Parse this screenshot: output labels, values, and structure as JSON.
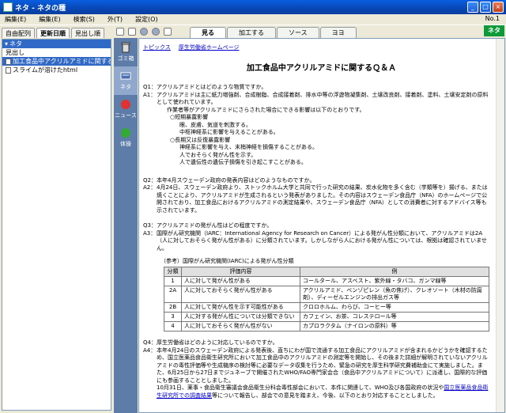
{
  "window": {
    "title": "ネタ - ネタの種",
    "buttons": [
      "_",
      "□",
      "×"
    ]
  },
  "menu": {
    "items": [
      "編集(E)",
      "編集(E)",
      "検索(S)",
      "外(T)",
      "設定(O)"
    ],
    "number": "No.1"
  },
  "left_tabs": [
    "自由配列",
    "更新日順",
    "見出し順"
  ],
  "tree": {
    "root": "ネタ",
    "items": [
      "見出し",
      "加工食品中アクリルアミドに関するＱ＆Ａ.html",
      "スライムが溶けたhtml"
    ]
  },
  "side_buttons": [
    "ゴミ箱",
    "ネタ",
    "ニュース",
    "体操"
  ],
  "tabs": [
    "見る",
    "加工する",
    "ソース",
    "ヨヨ"
  ],
  "logo": "ネタ",
  "links": [
    "トピックス",
    "厚生労働省ホームページ"
  ],
  "doc": {
    "title": "加工食品中アクリルアミドに関するＱ＆Ａ",
    "q1": {
      "label": "Q1：",
      "text": "アクリルアミドとはどのような物質ですか。"
    },
    "a1": {
      "label": "A1：",
      "text": "アクリルアミドは主に紙力増強剤、合成樹脂、合成接着剤、排水中等の浮遊物凝集剤、土壌改良剤、接着剤、塗料、土壌安定剤の原料として使われています。"
    },
    "a1_sub": [
      "作業者等がアクリルアミドにさらされた場合にできる影響は以下のとおりです。",
      "○短期暴露影響",
      "眼、皮膚、気道を刺激する。",
      "中枢神経系に影響を与えることがある。",
      "○長期又は反復暴露影響",
      "神経系に影響を与え、末梢神経を損傷することがある。",
      "人でおそらく発がん性を示す。",
      "人で遺伝性の遺伝子損傷を引き起こすことがある。"
    ],
    "q2": {
      "label": "Q2：",
      "text": "本年4月スウェーデン政府の発表内容はどのようなものですか。"
    },
    "a2": {
      "label": "A2：",
      "text": "4月24日、スウェーデン政府より、ストックホルム大学と共同で行った研究の結果、炭水化物を多く含む（芋類等を）揚げる、または焼くことにより、アクリルアミドが生成されるという発表がありました。その内容はスウェーデン食品庁（NFA）のホームページで公開されており、加工食品におけるアクリルアミドの測定結果や、スウェーデン食品庁（NFA）としての消費者に対するアドバイス等も示されています。"
    },
    "q3": {
      "label": "Q3：",
      "text": "アクリルアミドの発がん性はどの程度ですか。"
    },
    "a3": {
      "label": "A3：",
      "text": "国際がん研究機関（IARC：International Agency for Research on Cancer）による発がん性分類において、アクリルアミドは2A（人に対しておそらく発がん性がある）に分類されています。しかしながら人における発がん性については、根拠は確認されていません。"
    },
    "table_note": "（参考）国際がん研究機関(IARC)による発がん性分類",
    "table_headers": [
      "分類",
      "評価内容",
      "例"
    ],
    "table_rows": [
      [
        "1",
        "人に対して発がん性がある",
        "コールタール、アスベスト、紫外線・タバコ、ガンマ線等"
      ],
      [
        "2A",
        "人に対しておそらく発がん性がある",
        "アクリルアミド、ベンゾピレン（魚の焦げ）、クレオソート（木材の防腐剤）、ディーゼルエンジンの排出ガス等"
      ],
      [
        "2B",
        "人に対して発がん性を示す可能性がある",
        "クロロホルム、わらび、コーヒー等"
      ],
      [
        "3",
        "人に対する発がん性については分類できない",
        "カフェイン、お茶、コレステロール等"
      ],
      [
        "4",
        "人に対しておそらく発がん性がない",
        "カプロラクタム（ナイロンの原料）等"
      ]
    ],
    "q4": {
      "label": "Q4：",
      "text": "厚生労働省はどのように対応しているのですか。"
    },
    "a4": {
      "label": "A4：",
      "text": "本年4月24日のスウェーデン政府による発表後、直ちにわが国で流通する加工食品にアクリルアミドが含まれるかどうかを確認するため、国立医薬品食品衛生研究所において加工食品中のアクリルアミドの測定等を開始し、その後また詳細が解明されていないアクリルアミドの毒性評価等や生成機序の検討等に必要なデータ収集を行うため、緊急の研究を厚生科学研究費補助金にて実施しました。また、6月25日から27日までジュネーブで開催されたWHO/FAO専門家会合（食品中アクリルアミドについて）に派遣し、国際的な評価にも参画することとしました。"
    },
    "a4_cont": "10月31日、薬事・食品衛生審議会食品衛生分科会毒性部会において、本件に関連して、WHO及び各国政府の状況や",
    "a4_link": "国立医薬品食品衛生研究所での調査結果",
    "a4_end": "等について報告し、部会での意見を踏まえ、今後、以下のとおり対応することとしました。"
  }
}
